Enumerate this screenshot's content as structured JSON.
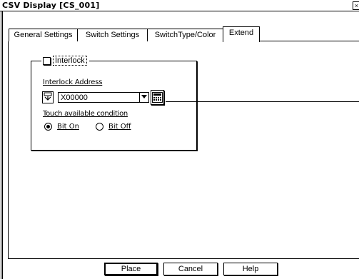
{
  "window": {
    "title": "CSV Display [CS_001]",
    "close_glyph": "×"
  },
  "tabs": [
    {
      "label": "General Settings"
    },
    {
      "label": "Switch Settings"
    },
    {
      "label": "SwitchType/Color"
    },
    {
      "label": "Extend"
    }
  ],
  "interlock": {
    "checkbox_label": "Interlock",
    "checked": false,
    "address_label": "Interlock Address",
    "address_icon": "address-type-icon",
    "address_value": "X00000",
    "keypad_icon": "keypad-icon",
    "touch_label": "Touch available condition",
    "options": [
      {
        "label": "Bit On",
        "selected": true
      },
      {
        "label": "Bit Off",
        "selected": false
      }
    ]
  },
  "buttons": {
    "place": "Place",
    "cancel": "Cancel",
    "help": "Help"
  }
}
